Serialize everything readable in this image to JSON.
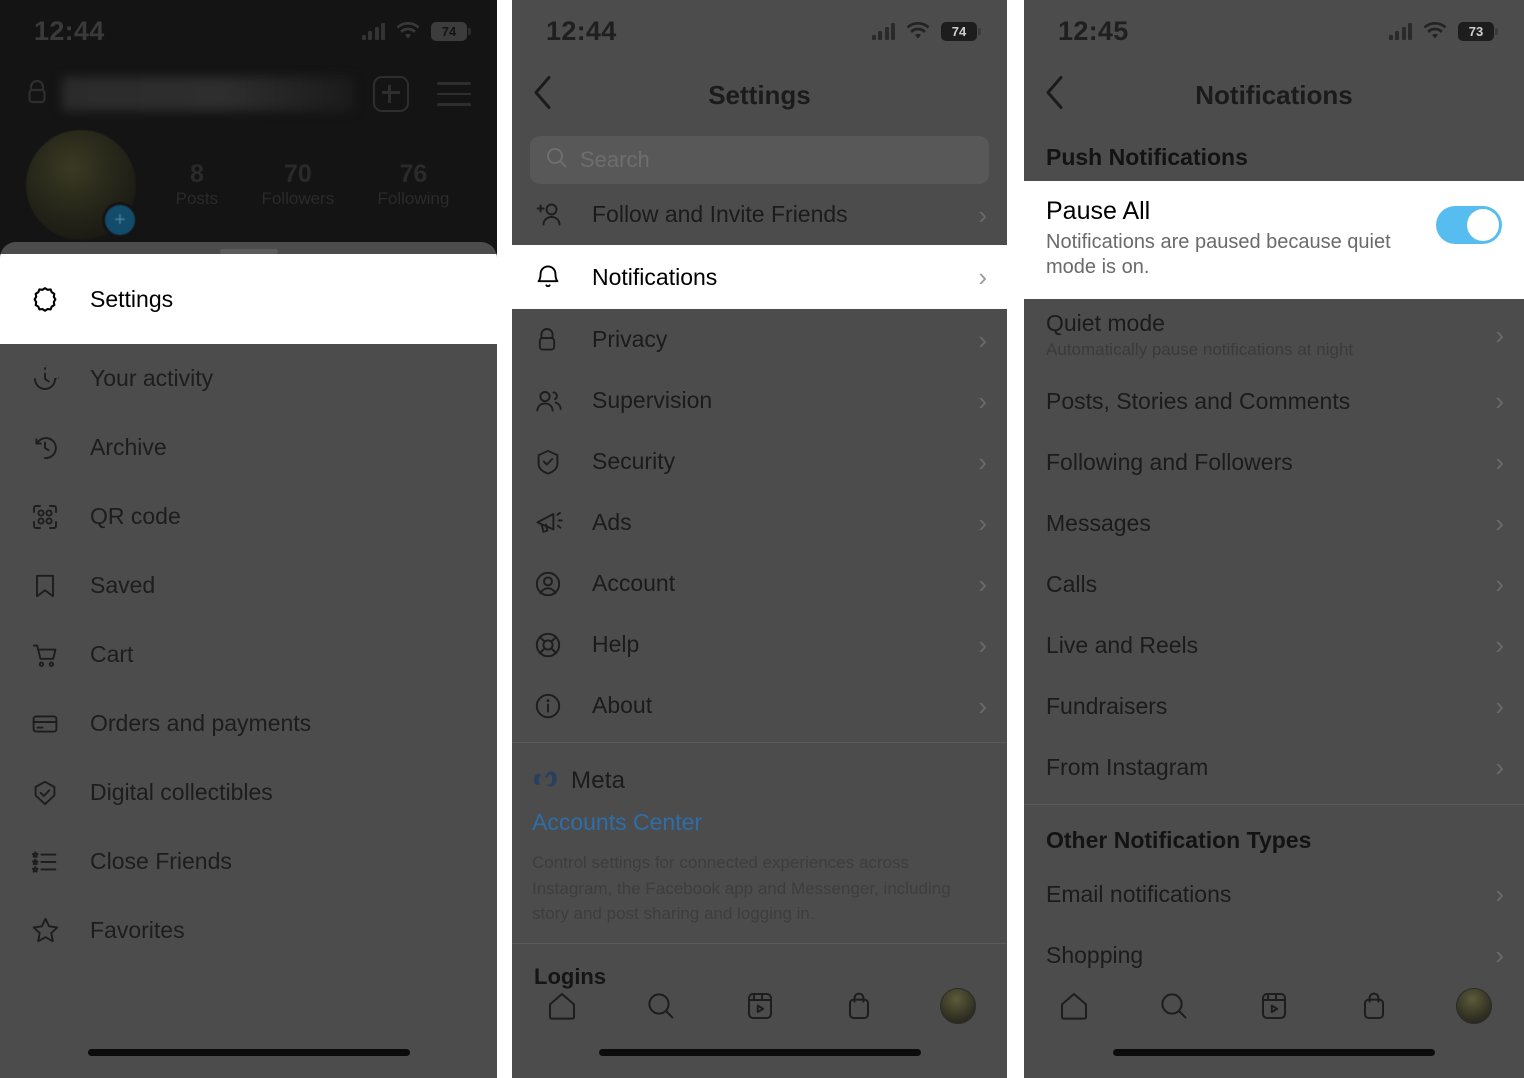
{
  "panel1": {
    "status": {
      "time": "12:44",
      "battery": "74",
      "wifi_icon": "wifi-icon",
      "cellular_icon": "cellular-signal-icon"
    },
    "profile": {
      "lock_icon": "lock-icon",
      "add_icon": "plus-square-icon",
      "menu_icon": "hamburger-menu-icon",
      "avatar_label": "profile-avatar",
      "stats": [
        {
          "num": "8",
          "label": "Posts"
        },
        {
          "num": "70",
          "label": "Followers"
        },
        {
          "num": "76",
          "label": "Following"
        }
      ]
    },
    "sheet": {
      "highlighted": {
        "label": "Settings",
        "icon": "settings-gear-icon"
      },
      "items": [
        {
          "label": "Your activity",
          "icon": "activity-clock-icon"
        },
        {
          "label": "Archive",
          "icon": "archive-clock-icon"
        },
        {
          "label": "QR code",
          "icon": "qr-code-icon"
        },
        {
          "label": "Saved",
          "icon": "bookmark-icon"
        },
        {
          "label": "Cart",
          "icon": "shopping-cart-icon"
        },
        {
          "label": "Orders and payments",
          "icon": "credit-card-icon"
        },
        {
          "label": "Digital collectibles",
          "icon": "shield-check-icon"
        },
        {
          "label": "Close Friends",
          "icon": "list-star-icon"
        },
        {
          "label": "Favorites",
          "icon": "star-icon"
        }
      ]
    }
  },
  "panel2": {
    "status": {
      "time": "12:44",
      "battery": "74"
    },
    "header": {
      "title": "Settings",
      "back_icon": "back-chevron-icon"
    },
    "search": {
      "placeholder": "Search",
      "icon": "search-icon"
    },
    "items": [
      {
        "label": "Follow and Invite Friends",
        "icon": "add-person-icon",
        "selected": false
      },
      {
        "label": "Notifications",
        "icon": "bell-icon",
        "selected": true
      },
      {
        "label": "Privacy",
        "icon": "lock-icon",
        "selected": false
      },
      {
        "label": "Supervision",
        "icon": "two-people-icon",
        "selected": false
      },
      {
        "label": "Security",
        "icon": "shield-check-icon",
        "selected": false
      },
      {
        "label": "Ads",
        "icon": "megaphone-icon",
        "selected": false
      },
      {
        "label": "Account",
        "icon": "account-circle-icon",
        "selected": false
      },
      {
        "label": "Help",
        "icon": "life-ring-icon",
        "selected": false
      },
      {
        "label": "About",
        "icon": "info-circle-icon",
        "selected": false
      }
    ],
    "meta": {
      "logo_icon": "meta-infinity-icon",
      "wordmark": "Meta",
      "link": "Accounts Center",
      "description": "Control settings for connected experiences across Instagram, the Facebook app and Messenger, including story and post sharing and logging in.",
      "link_color": "#2e6ea8"
    },
    "logins_heading": "Logins",
    "tabbar": [
      {
        "icon": "home-icon"
      },
      {
        "icon": "search-icon"
      },
      {
        "icon": "reels-icon"
      },
      {
        "icon": "shop-bag-icon"
      },
      {
        "icon": "profile-avatar-icon"
      }
    ]
  },
  "panel3": {
    "status": {
      "time": "12:45",
      "battery": "73"
    },
    "header": {
      "title": "Notifications",
      "back_icon": "back-chevron-icon"
    },
    "push_heading": "Push Notifications",
    "pause": {
      "title": "Pause All",
      "subtitle": "Notifications are paused because quiet mode is on.",
      "toggle_on": true,
      "toggle_color": "#57bdf0"
    },
    "items": [
      {
        "label": "Quiet mode",
        "sub": "Automatically pause notifications at night"
      },
      {
        "label": "Posts, Stories and Comments",
        "sub": ""
      },
      {
        "label": "Following and Followers",
        "sub": ""
      },
      {
        "label": "Messages",
        "sub": ""
      },
      {
        "label": "Calls",
        "sub": ""
      },
      {
        "label": "Live and Reels",
        "sub": ""
      },
      {
        "label": "Fundraisers",
        "sub": ""
      },
      {
        "label": "From Instagram",
        "sub": ""
      }
    ],
    "other_heading": "Other Notification Types",
    "other_items": [
      {
        "label": "Email notifications"
      },
      {
        "label": "Shopping"
      }
    ],
    "tabbar": [
      {
        "icon": "home-icon"
      },
      {
        "icon": "search-icon"
      },
      {
        "icon": "reels-icon"
      },
      {
        "icon": "shop-bag-icon"
      },
      {
        "icon": "profile-avatar-icon"
      }
    ]
  }
}
